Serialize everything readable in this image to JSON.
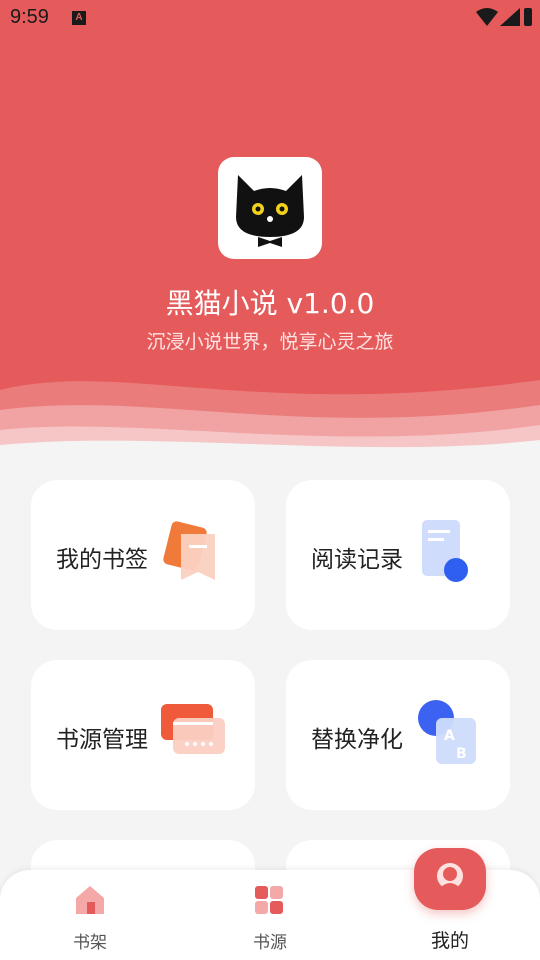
{
  "status_bar": {
    "time": "9:59",
    "notification_letter": "A"
  },
  "header": {
    "app_name": "黑猫小说 v1.0.0",
    "slogan": "沉浸小说世界，悦享心灵之旅",
    "background_color": "#e55b5b"
  },
  "menu": {
    "items": [
      {
        "label": "我的书签",
        "icon": "bookmark-icon"
      },
      {
        "label": "阅读记录",
        "icon": "reading-history-icon"
      },
      {
        "label": "书源管理",
        "icon": "source-manage-icon"
      },
      {
        "label": "替换净化",
        "icon": "replace-purify-icon"
      }
    ]
  },
  "bottom_nav": {
    "tabs": [
      {
        "label": "书架",
        "icon": "bookshelf-icon",
        "active": false
      },
      {
        "label": "书源",
        "icon": "book-source-icon",
        "active": false
      },
      {
        "label": "我的",
        "icon": "profile-icon",
        "active": true
      }
    ],
    "accent_color": "#e55b5b"
  }
}
